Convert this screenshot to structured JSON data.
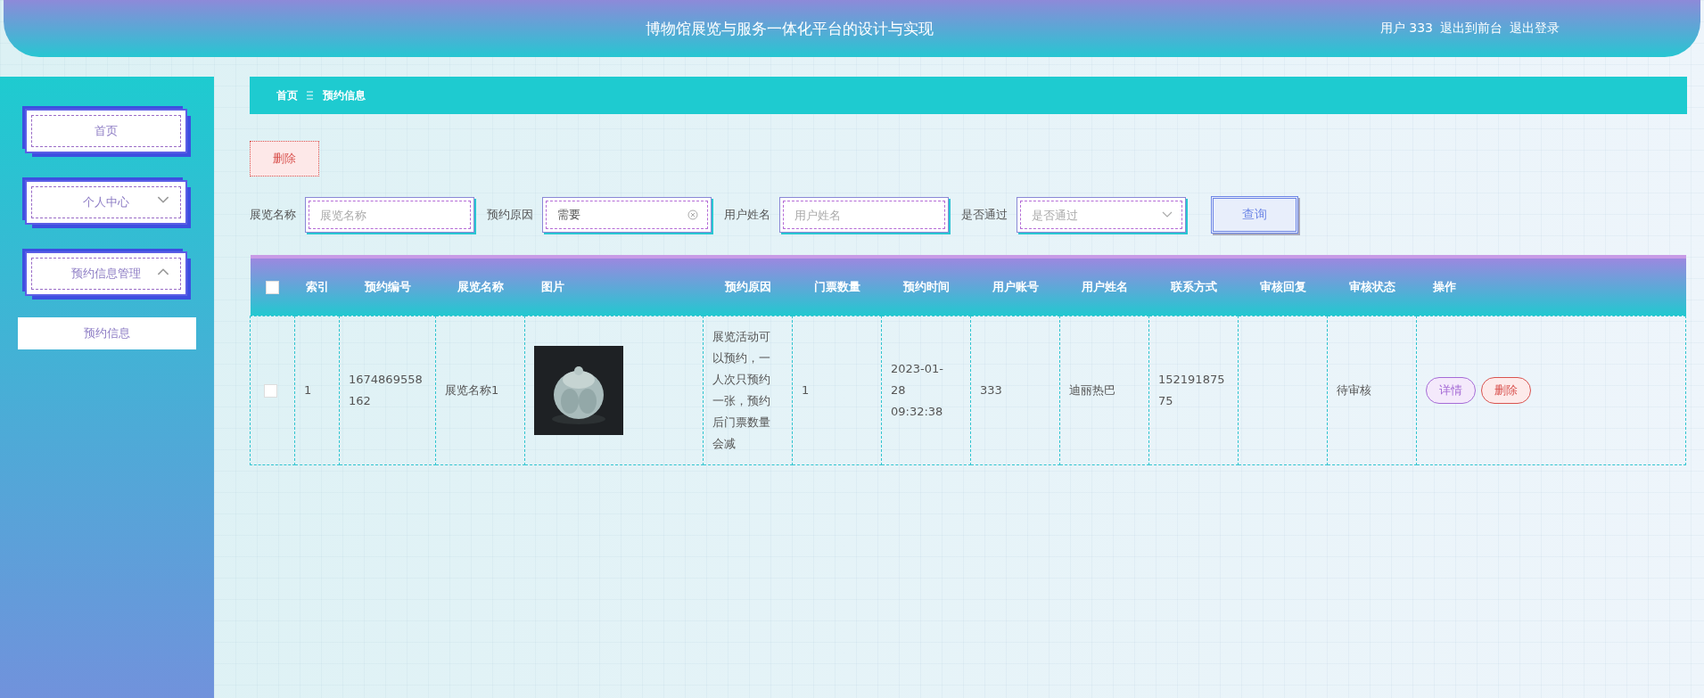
{
  "header": {
    "title": "博物馆展览与服务一体化平台的设计与实现",
    "user": "用户 333",
    "links": [
      "退出到前台",
      "退出登录"
    ]
  },
  "sidebar": {
    "items": [
      {
        "label": "首页",
        "kind": "link"
      },
      {
        "label": "个人中心",
        "kind": "menu",
        "expanded": false
      },
      {
        "label": "预约信息管理",
        "kind": "menu",
        "expanded": true,
        "children": [
          {
            "label": "预约信息",
            "selected": false
          }
        ]
      }
    ]
  },
  "breadcrumb": [
    "首页",
    "预约信息"
  ],
  "toolbar": {
    "delete": "删除"
  },
  "search": {
    "fields": [
      {
        "label": "展览名称",
        "kind": "text",
        "placeholder": "展览名称"
      },
      {
        "label": "预约原因",
        "kind": "text",
        "value": "需要"
      },
      {
        "label": "用户姓名",
        "kind": "text",
        "placeholder": "用户姓名"
      },
      {
        "label": "是否通过",
        "kind": "select",
        "placeholder": "是否通过"
      }
    ],
    "button": "查询"
  },
  "table": {
    "select_all": {
      "checked": false
    },
    "columns": [
      "索引",
      "预约编号",
      "展览名称",
      "图片",
      "预约原因",
      "门票数量",
      "预约时间",
      "用户账号",
      "用户姓名",
      "联系方式",
      "审核回复",
      "审核状态",
      "操作"
    ],
    "rows": [
      {
        "checked": false,
        "cells": [
          "1",
          "1674869558162",
          "展览名称1",
          {
            "kind": "picture"
          },
          "展览活动可以预约，一人次只预约一张，预约后门票数量会减",
          "1",
          "2023-01-28 09:32:38",
          "333",
          "迪丽热巴",
          "15219187575",
          "",
          "待审核"
        ],
        "actions": [
          {
            "label": "详情",
            "kind": "detail"
          },
          {
            "label": "删除",
            "kind": "delete"
          }
        ]
      }
    ]
  }
}
